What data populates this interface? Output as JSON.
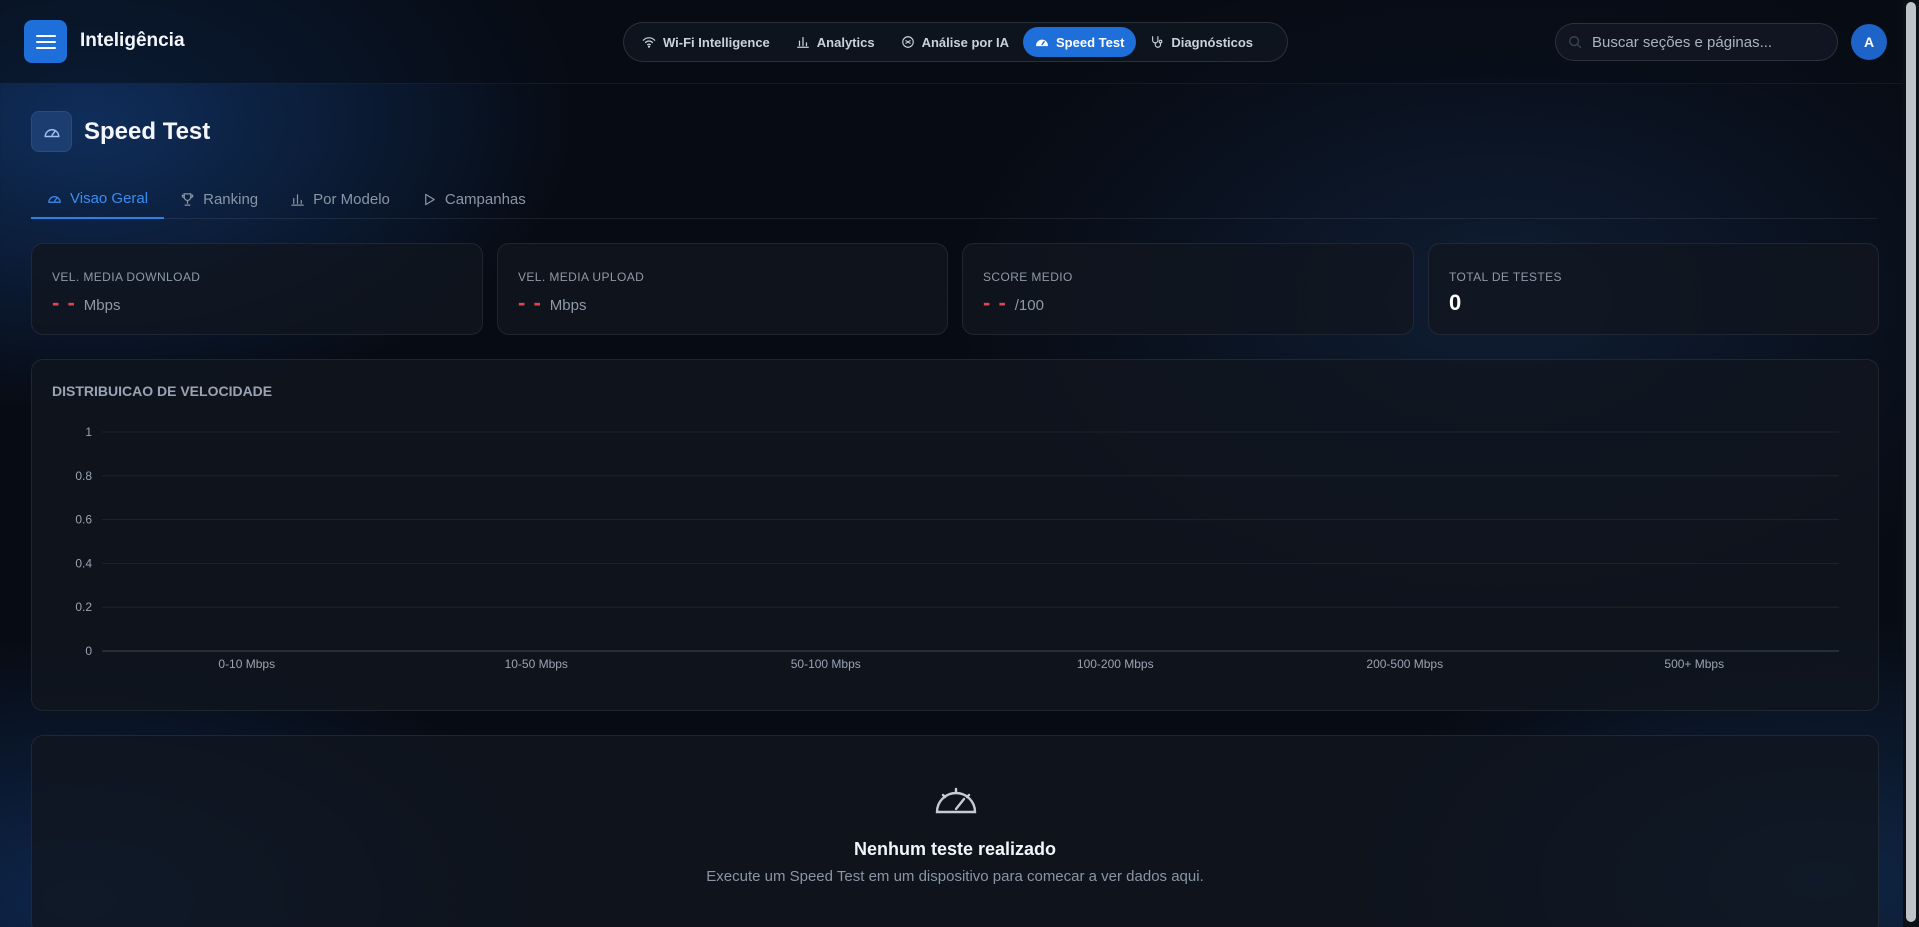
{
  "header": {
    "app_title": "Inteligência",
    "nav": [
      {
        "label": "Wi-Fi Intelligence",
        "icon": "wifi-icon"
      },
      {
        "label": "Analytics",
        "icon": "bar-chart-icon"
      },
      {
        "label": "Análise por IA",
        "icon": "ai-brain-icon"
      },
      {
        "label": "Speed Test",
        "icon": "gauge-icon",
        "active": true
      },
      {
        "label": "Diagnósticos",
        "icon": "stethoscope-icon"
      }
    ],
    "search_placeholder": "Buscar seções e páginas...",
    "avatar_initial": "A"
  },
  "page": {
    "title": "Speed Test",
    "tabs": [
      {
        "label": "Visao Geral",
        "icon": "gauge-icon",
        "active": true
      },
      {
        "label": "Ranking",
        "icon": "trophy-icon"
      },
      {
        "label": "Por Modelo",
        "icon": "bar-chart-icon"
      },
      {
        "label": "Campanhas",
        "icon": "play-icon"
      }
    ]
  },
  "stats": [
    {
      "label": "VEL. MEDIA DOWNLOAD",
      "value": "- -",
      "unit": "Mbps"
    },
    {
      "label": "VEL. MEDIA UPLOAD",
      "value": "- -",
      "unit": "Mbps"
    },
    {
      "label": "SCORE MEDIO",
      "value": "- -",
      "unit": "/100"
    },
    {
      "label": "TOTAL DE TESTES",
      "value": "0",
      "unit": ""
    }
  ],
  "chart_data": {
    "type": "bar",
    "title": "DISTRIBUICAO DE VELOCIDADE",
    "categories": [
      "0-10 Mbps",
      "10-50 Mbps",
      "50-100 Mbps",
      "100-200 Mbps",
      "200-500 Mbps",
      "500+ Mbps"
    ],
    "values": [
      0,
      0,
      0,
      0,
      0,
      0
    ],
    "ylim": [
      0,
      1
    ],
    "yticks": [
      "0",
      "0.2",
      "0.4",
      "0.6",
      "0.8",
      "1"
    ],
    "yticks_values": [
      0,
      0.2,
      0.4,
      0.6,
      0.8,
      1
    ],
    "grid": true,
    "xlabel": "",
    "ylabel": ""
  },
  "empty_state": {
    "title": "Nenhum teste realizado",
    "subtitle": "Execute um Speed Test em um dispositivo para comecar a ver dados aqui.",
    "icon": "gauge-icon"
  },
  "colors": {
    "accent": "#1e6fd9",
    "tab_active": "#3b8ef0",
    "dash": "#e4444f"
  }
}
